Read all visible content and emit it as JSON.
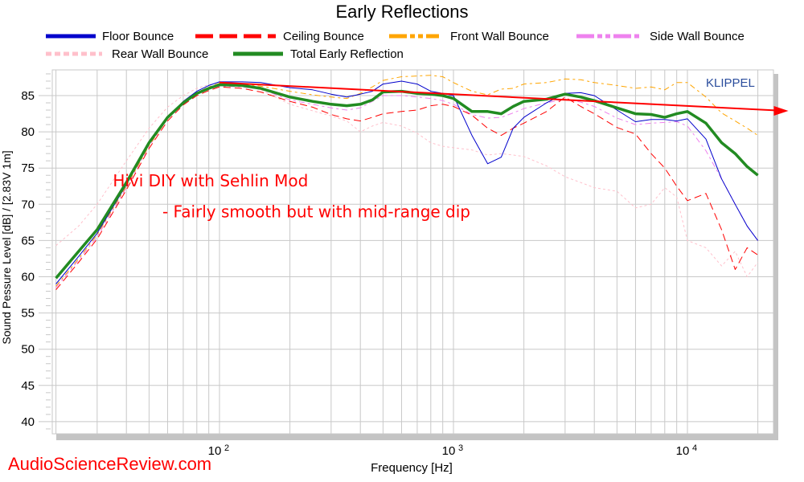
{
  "chart_data": {
    "type": "line",
    "title": "Early Reflections",
    "xlabel": "Frequency [Hz]",
    "ylabel": "Sound Pessure Level [dB]  / [2.83V 1m]",
    "xscale": "log",
    "xlim": [
      18,
      23000
    ],
    "ylim": [
      38.5,
      88.5
    ],
    "grid": true,
    "legend_position": "top",
    "x_tick_labels": [
      {
        "value": 100,
        "base": "10",
        "exp": "2"
      },
      {
        "value": 1000,
        "base": "10",
        "exp": "3"
      },
      {
        "value": 10000,
        "base": "10",
        "exp": "4"
      }
    ],
    "y_ticks": [
      40,
      45,
      50,
      55,
      60,
      65,
      70,
      75,
      80,
      85
    ],
    "x": [
      20,
      25,
      30,
      40,
      50,
      60,
      70,
      80,
      90,
      100,
      125,
      150,
      200,
      250,
      300,
      350,
      400,
      450,
      500,
      600,
      700,
      800,
      900,
      1000,
      1200,
      1400,
      1600,
      1800,
      2000,
      2500,
      3000,
      3500,
      4000,
      5000,
      6000,
      7000,
      8000,
      9000,
      10000,
      12000,
      14000,
      16000,
      18000,
      20000
    ],
    "series": [
      {
        "name": "Floor Bounce",
        "color": "#0000cc",
        "style": "solid",
        "width": 1,
        "values": [
          59.0,
          62.8,
          66.0,
          72.7,
          78.3,
          82.0,
          84.2,
          85.6,
          86.4,
          86.9,
          86.9,
          86.8,
          86.1,
          85.8,
          85.2,
          84.8,
          85.2,
          85.6,
          86.6,
          87.0,
          86.6,
          85.6,
          85.3,
          85.0,
          79.5,
          75.6,
          76.5,
          80.5,
          82.0,
          84.0,
          85.3,
          85.4,
          85.0,
          83.0,
          81.4,
          81.7,
          81.7,
          81.5,
          81.8,
          79.0,
          73.5,
          70.0,
          67.0,
          65.0
        ]
      },
      {
        "name": "Ceiling Bounce",
        "color": "#ff0000",
        "style": "dashed-long",
        "width": 1,
        "values": [
          58.2,
          62.0,
          65.2,
          72.0,
          77.7,
          81.5,
          83.7,
          85.0,
          85.7,
          86.2,
          86.0,
          85.5,
          84.2,
          83.4,
          82.4,
          81.8,
          81.5,
          82.0,
          82.5,
          82.8,
          83.0,
          83.6,
          83.8,
          83.5,
          82.3,
          80.5,
          79.5,
          80.5,
          81.2,
          82.8,
          84.8,
          83.5,
          82.5,
          80.6,
          79.7,
          77.0,
          75.0,
          72.5,
          70.5,
          71.5,
          66.5,
          61.0,
          64.0,
          63.0
        ]
      },
      {
        "name": "Front Wall Bounce",
        "color": "#ffa500",
        "style": "dash-dot",
        "width": 1,
        "values": [
          58.7,
          62.5,
          65.8,
          72.5,
          78.1,
          81.8,
          84.0,
          85.4,
          86.2,
          86.7,
          86.6,
          86.3,
          85.6,
          85.1,
          84.8,
          84.6,
          85.3,
          86.2,
          87.1,
          87.6,
          87.7,
          87.8,
          87.6,
          86.8,
          85.6,
          85.1,
          85.9,
          86.0,
          86.6,
          86.8,
          87.3,
          87.2,
          86.8,
          86.4,
          86.0,
          86.2,
          85.8,
          86.8,
          86.8,
          84.8,
          82.6,
          81.5,
          80.5,
          79.5
        ]
      },
      {
        "name": "Side Wall Bounce",
        "color": "#ee82ee",
        "style": "dash-dot",
        "width": 1,
        "values": [
          58.5,
          62.3,
          65.5,
          72.3,
          78.0,
          81.8,
          83.9,
          85.2,
          85.9,
          86.3,
          86.2,
          85.9,
          84.4,
          83.8,
          83.3,
          83.0,
          83.3,
          84.2,
          85.0,
          85.0,
          84.8,
          84.6,
          84.3,
          83.8,
          82.4,
          81.9,
          82.0,
          82.6,
          83.2,
          84.0,
          84.5,
          84.1,
          83.5,
          81.9,
          81.0,
          81.2,
          81.3,
          81.4,
          80.8,
          77.4,
          73.5,
          70.0,
          67.0,
          65.0
        ]
      },
      {
        "name": "Rear Wall Bounce",
        "color": "#ffc0cb",
        "style": "dotted",
        "width": 1,
        "values": [
          64.3,
          67.0,
          70.0,
          76.0,
          80.5,
          83.4,
          85.0,
          86.0,
          86.5,
          86.8,
          86.5,
          85.8,
          83.8,
          82.9,
          82.2,
          81.5,
          80.0,
          80.8,
          81.3,
          80.8,
          79.8,
          78.5,
          78.0,
          77.8,
          77.5,
          76.8,
          77.0,
          76.8,
          76.6,
          75.3,
          73.8,
          73.0,
          72.3,
          71.8,
          69.5,
          70.0,
          72.3,
          71.0,
          65.0,
          64.0,
          61.5,
          63.5,
          60.0,
          62.0
        ]
      },
      {
        "name": "Total Early Reflection",
        "color": "#228b22",
        "style": "solid",
        "width": 3.5,
        "values": [
          59.8,
          63.5,
          66.5,
          73.0,
          78.5,
          82.0,
          84.0,
          85.3,
          86.0,
          86.5,
          86.4,
          86.0,
          84.8,
          84.2,
          83.8,
          83.6,
          83.8,
          84.4,
          85.5,
          85.6,
          85.3,
          85.2,
          85.0,
          84.6,
          82.8,
          82.8,
          82.5,
          83.5,
          84.2,
          84.5,
          85.2,
          84.8,
          84.3,
          83.3,
          82.5,
          82.4,
          82.0,
          82.5,
          82.8,
          81.2,
          78.5,
          77.0,
          75.2,
          74.0
        ]
      }
    ],
    "trend_arrow": {
      "color": "#ff0000",
      "from": {
        "x": 100,
        "y": 86.8
      },
      "to": {
        "x": 27000,
        "y": 82.9
      }
    },
    "annotations": [
      {
        "text": "Hivi DIY with Sehlin Mod",
        "x": 35,
        "y": 72.5,
        "color": "#ff0000"
      },
      {
        "text": "- Fairly smooth but with mid-range dip",
        "x": 57,
        "y": 68.2,
        "color": "#ff0000"
      }
    ],
    "brand_label": "KLIPPEL"
  },
  "watermark": "AudioScienceReview.com"
}
